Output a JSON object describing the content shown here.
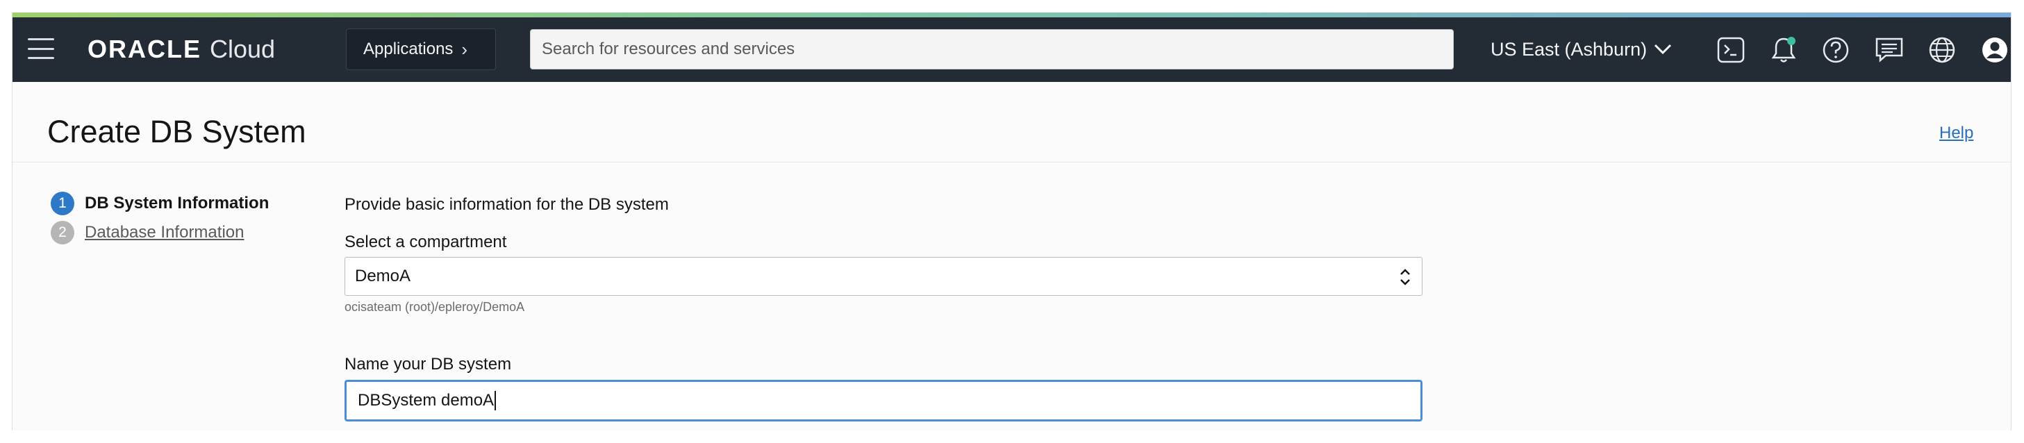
{
  "header": {
    "brand_oracle": "ORACLE",
    "brand_cloud": "Cloud",
    "apps_label": "Applications",
    "search_placeholder": "Search for resources and services",
    "region_label": "US East (Ashburn)",
    "icons": [
      "menu-icon",
      "chevron-right-icon",
      "chevron-down-icon",
      "terminal-icon",
      "bell-icon",
      "help-circle-icon",
      "chat-icon",
      "globe-icon",
      "user-avatar-icon"
    ],
    "notification_dot_color": "#3dbfa0"
  },
  "page": {
    "title": "Create DB System",
    "help_link": "Help"
  },
  "steps": [
    {
      "number": "1",
      "label": "DB System Information",
      "state": "active"
    },
    {
      "number": "2",
      "label": "Database Information",
      "state": "inactive"
    }
  ],
  "form": {
    "intro": "Provide basic information for the DB system",
    "compartment_label": "Select a compartment",
    "compartment_value": "DemoA",
    "compartment_path": "ocisateam (root)/epleroy/DemoA",
    "name_label": "Name your DB system",
    "name_value": "DBSystem demoA"
  },
  "colors": {
    "topbar": "#232b35",
    "link": "#2a6fb8",
    "active_step": "#2d79c7",
    "focus_border": "#4d8dd6"
  }
}
